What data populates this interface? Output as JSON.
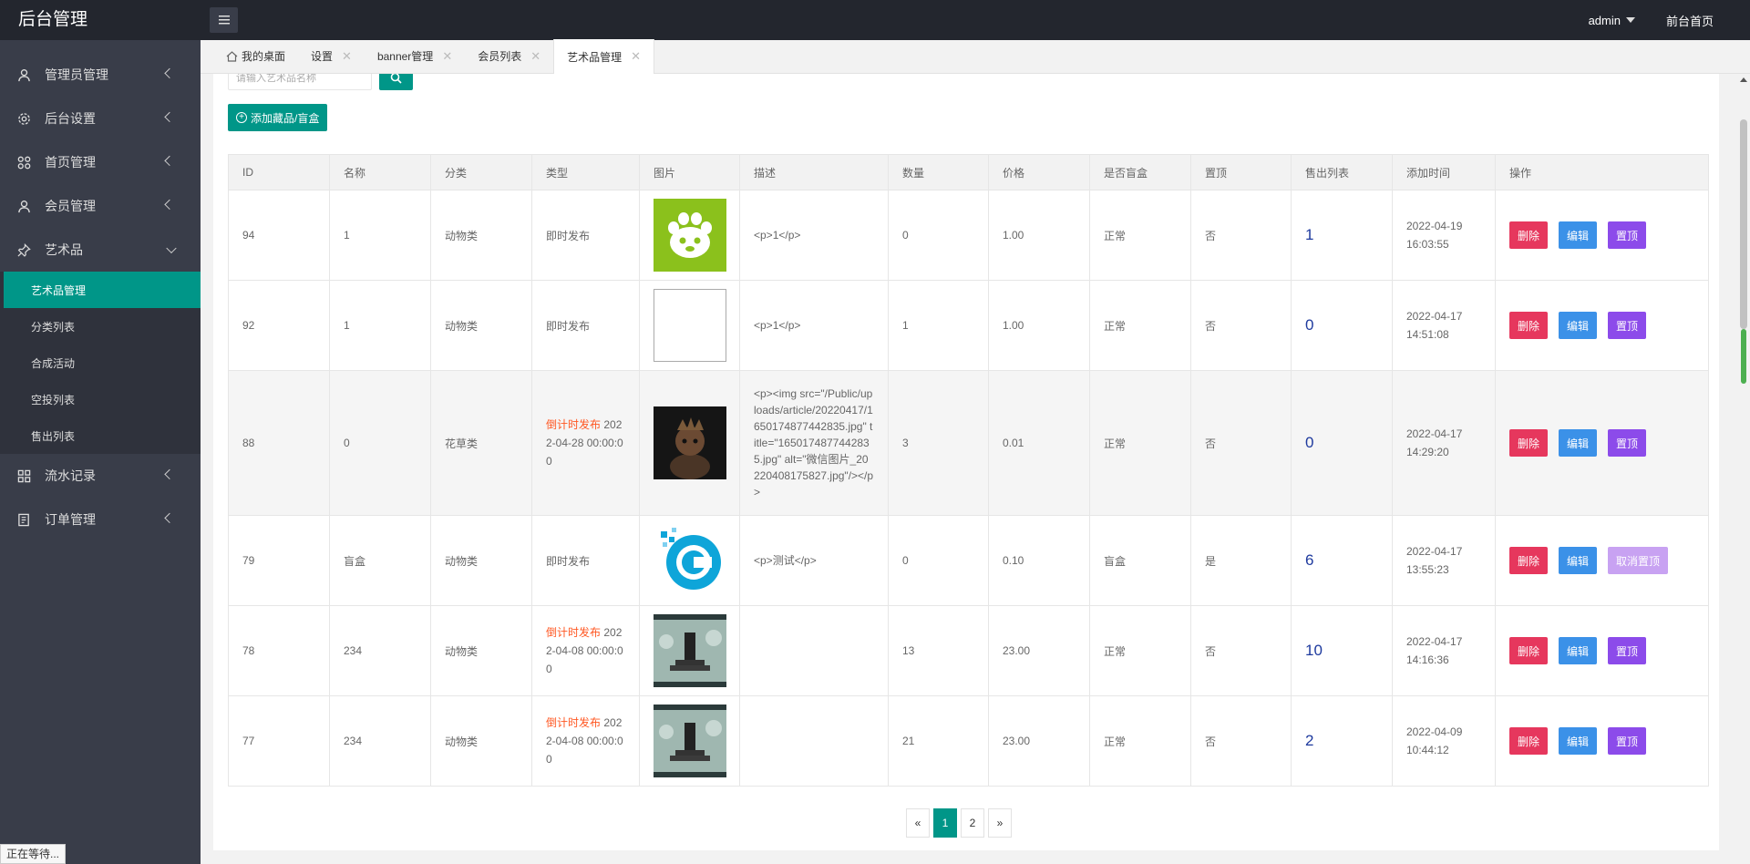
{
  "header": {
    "logo": "后台管理",
    "user": "admin",
    "front_link": "前台首页"
  },
  "sidebar": {
    "items": [
      {
        "label": "管理员管理",
        "icon": "user-icon"
      },
      {
        "label": "后台设置",
        "icon": "gear-icon"
      },
      {
        "label": "首页管理",
        "icon": "grid-icon"
      },
      {
        "label": "会员管理",
        "icon": "user-icon"
      },
      {
        "label": "艺术品",
        "icon": "pin-icon"
      },
      {
        "label": "流水记录",
        "icon": "grid-icon"
      },
      {
        "label": "订单管理",
        "icon": "document-icon"
      }
    ],
    "sub_items": [
      "艺术品管理",
      "分类列表",
      "合成活动",
      "空投列表",
      "售出列表"
    ]
  },
  "tabs": [
    {
      "label": "我的桌面"
    },
    {
      "label": "设置",
      "close": "✕"
    },
    {
      "label": "banner管理",
      "close": "✕"
    },
    {
      "label": "会员列表",
      "close": "✕"
    },
    {
      "label": "艺术品管理",
      "close": "✕"
    }
  ],
  "search": {
    "placeholder": "请输入艺术品名称"
  },
  "add_button": "添加藏品/盲盒",
  "table": {
    "headers": [
      "ID",
      "名称",
      "分类",
      "类型",
      "图片",
      "描述",
      "数量",
      "价格",
      "是否盲盒",
      "置顶",
      "售出列表",
      "添加时间",
      "操作"
    ],
    "rows": [
      {
        "id": "94",
        "name": "1",
        "cat": "动物类",
        "type": "即时发布",
        "type_cd": "",
        "type_rest": "",
        "desc": "<p>1</p>",
        "qty": "0",
        "price": "1.00",
        "blind": "正常",
        "top": "否",
        "sold": "1",
        "time": "2022-04-19 16:03:55",
        "top_btn": "置顶"
      },
      {
        "id": "92",
        "name": "1",
        "cat": "动物类",
        "type": "即时发布",
        "type_cd": "",
        "type_rest": "",
        "desc": "<p>1</p>",
        "qty": "1",
        "price": "1.00",
        "blind": "正常",
        "top": "否",
        "sold": "0",
        "time": "2022-04-17 14:51:08",
        "top_btn": "置顶"
      },
      {
        "id": "88",
        "name": "0",
        "cat": "花草类",
        "type": "",
        "type_cd": "倒计时发布",
        "type_rest": " 2022-04-28 00:00:00",
        "desc": "<p><img src=\"/Public/uploads/article/20220417/1650174877442835.jpg\" title=\"1650174877442835.jpg\" alt=\"微信图片_20220408175827.jpg\"/></p>",
        "qty": "3",
        "price": "0.01",
        "blind": "正常",
        "top": "否",
        "sold": "0",
        "time": "2022-04-17 14:29:20",
        "top_btn": "置顶"
      },
      {
        "id": "79",
        "name": "盲盒",
        "cat": "动物类",
        "type": "即时发布",
        "type_cd": "",
        "type_rest": "",
        "desc": "<p>测试</p>",
        "qty": "0",
        "price": "0.10",
        "blind": "盲盒",
        "top": "是",
        "sold": "6",
        "time": "2022-04-17 13:55:23",
        "top_btn": "取消置顶"
      },
      {
        "id": "78",
        "name": "234",
        "cat": "动物类",
        "type": "",
        "type_cd": "倒计时发布",
        "type_rest": " 2022-04-08 00:00:00",
        "desc": "",
        "qty": "13",
        "price": "23.00",
        "blind": "正常",
        "top": "否",
        "sold": "10",
        "time": "2022-04-17 14:16:36",
        "top_btn": "置顶"
      },
      {
        "id": "77",
        "name": "234",
        "cat": "动物类",
        "type": "",
        "type_cd": "倒计时发布",
        "type_rest": " 2022-04-08 00:00:00",
        "desc": "",
        "qty": "21",
        "price": "23.00",
        "blind": "正常",
        "top": "否",
        "sold": "2",
        "time": "2022-04-09 10:44:12",
        "top_btn": "置顶"
      }
    ],
    "delete_label": "删除",
    "edit_label": "编辑"
  },
  "pagination": {
    "prev": "«",
    "pages": [
      "1",
      "2"
    ],
    "next": "»"
  },
  "status_bar": "正在等待...",
  "colors": {
    "primary": "#009688",
    "delete": "#e6375d",
    "edit": "#3b91e8",
    "top": "#8c4bea",
    "countdown": "#ff5722"
  }
}
